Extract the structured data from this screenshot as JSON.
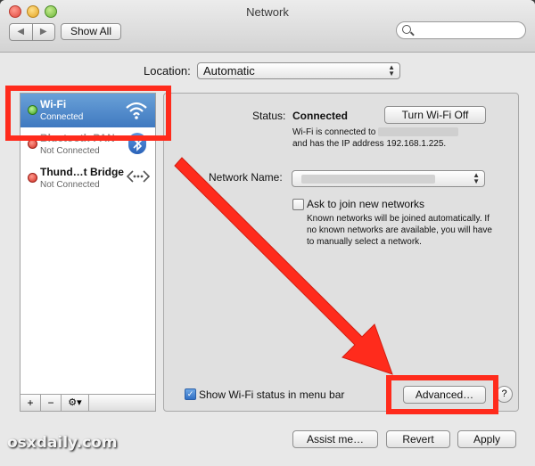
{
  "window": {
    "title": "Network"
  },
  "toolbar": {
    "back_forward": [
      "◀",
      "▶"
    ],
    "show_all_label": "Show All",
    "search_placeholder": ""
  },
  "location": {
    "label": "Location:",
    "value": "Automatic"
  },
  "services": [
    {
      "name": "Wi-Fi",
      "status": "Connected",
      "dot": "green",
      "icon": "wifi-icon",
      "selected": true
    },
    {
      "name": "Bluetooth PAN",
      "status": "Not Connected",
      "dot": "red",
      "icon": "bluetooth-icon",
      "selected": false
    },
    {
      "name": "Thund…t Bridge",
      "status": "Not Connected",
      "dot": "red",
      "icon": "thunderbolt-bridge-icon",
      "selected": false
    }
  ],
  "sidebar_bottom": {
    "add": "+",
    "remove": "−",
    "gear": "⚙▾"
  },
  "status": {
    "label": "Status:",
    "value": "Connected",
    "turn_off_label": "Turn Wi-Fi Off",
    "desc_line1": "Wi-Fi is connected to",
    "desc_line2": "and has the IP address 192.168.1.225."
  },
  "network_name": {
    "label": "Network Name:",
    "value": ""
  },
  "ask_to_join": {
    "label": "Ask to join new networks",
    "checked": false,
    "description": "Known networks will be joined automatically. If no known networks are available, you will have to manually select a network."
  },
  "show_status": {
    "label": "Show Wi-Fi status in menu bar",
    "checked": true
  },
  "buttons": {
    "advanced": "Advanced…",
    "help": "?",
    "assist": "Assist me…",
    "revert": "Revert",
    "apply": "Apply"
  },
  "watermark": "osxdaily.com",
  "colors": {
    "annotation_red": "#ff2b1c",
    "selection_blue": "#3f79c0"
  }
}
